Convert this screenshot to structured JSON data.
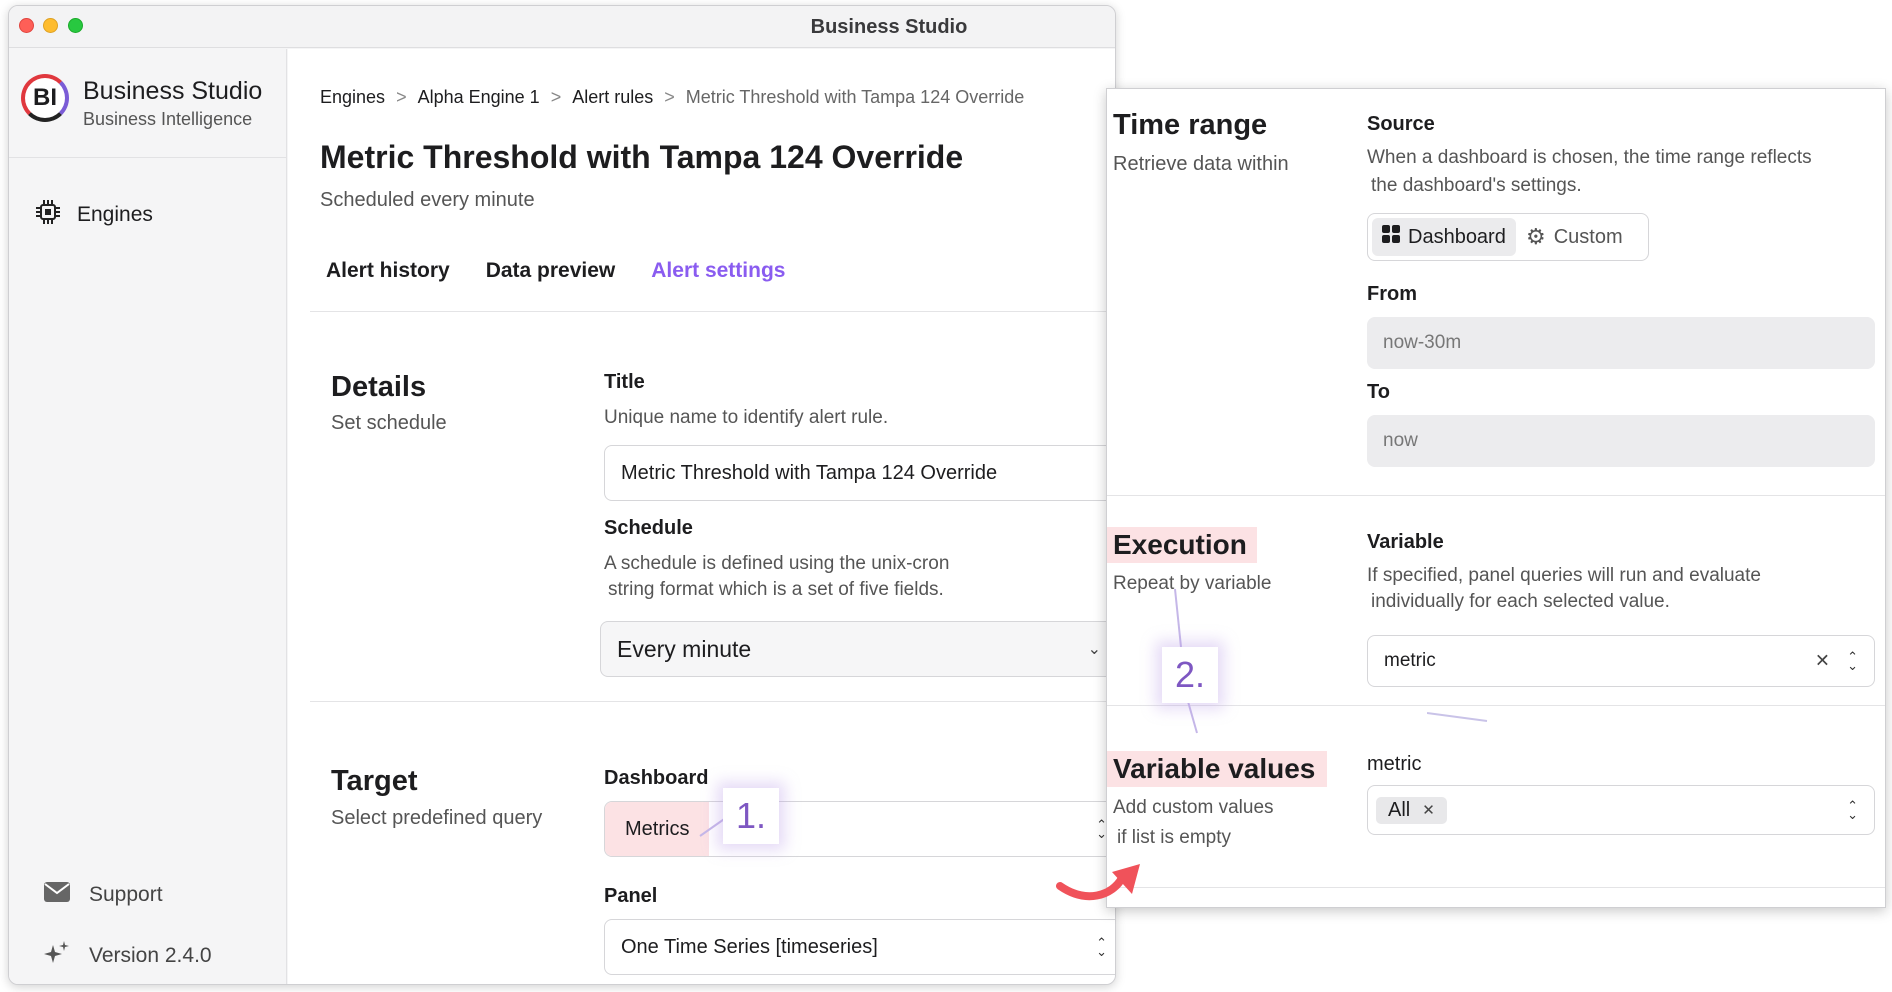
{
  "window": {
    "title": "Business Studio"
  },
  "sidebar": {
    "app_name": "Business Studio",
    "app_subtitle": "Business Intelligence",
    "logo_text": "BI",
    "nav": [
      {
        "label": "Engines",
        "icon": "chip-icon"
      }
    ],
    "footer": [
      {
        "label": "Support",
        "icon": "mail-icon"
      },
      {
        "label": "Version 2.4.0",
        "icon": "sparkles-icon"
      }
    ]
  },
  "breadcrumb": [
    "Engines",
    "Alpha Engine 1",
    "Alert rules",
    "Metric Threshold with Tampa 124 Override"
  ],
  "page": {
    "title": "Metric Threshold with Tampa 124 Override",
    "subtitle": "Scheduled every minute"
  },
  "tabs": [
    {
      "label": "Alert history",
      "active": false
    },
    {
      "label": "Data preview",
      "active": false
    },
    {
      "label": "Alert settings",
      "active": true
    }
  ],
  "details": {
    "heading": "Details",
    "subheading": "Set schedule",
    "title_label": "Title",
    "title_desc": "Unique name to identify alert rule.",
    "title_value": "Metric Threshold with Tampa 124 Override",
    "schedule_label": "Schedule",
    "schedule_desc_1": "A schedule is defined using the unix-cron",
    "schedule_desc_2": "string format which is a set of five fields.",
    "schedule_value": "Every minute"
  },
  "target": {
    "heading": "Target",
    "subheading": "Select predefined query",
    "dashboard_label": "Dashboard",
    "dashboard_value": "Metrics",
    "panel_label": "Panel",
    "panel_value": "One Time Series [timeseries]"
  },
  "time_range": {
    "heading": "Time range",
    "subheading": "Retrieve data within",
    "source_label": "Source",
    "source_desc_1": "When a dashboard is chosen, the time range reflects",
    "source_desc_2": "the dashboard's settings.",
    "options": [
      {
        "label": "Dashboard",
        "icon": "grid-icon",
        "selected": true
      },
      {
        "label": "Custom",
        "icon": "gear-icon",
        "selected": false
      }
    ],
    "from_label": "From",
    "from_value": "now-30m",
    "to_label": "To",
    "to_value": "now"
  },
  "execution": {
    "heading": "Execution",
    "subheading": "Repeat by variable",
    "variable_label": "Variable",
    "variable_desc_1": "If specified, panel queries will run and evaluate",
    "variable_desc_2": "individually for each selected value.",
    "variable_value": "metric"
  },
  "variable_values": {
    "heading": "Variable values",
    "subheading_1": "Add custom values",
    "subheading_2": "if list is empty",
    "field_label": "metric",
    "chip": "All"
  },
  "annotations": {
    "one": "1.",
    "two": "2."
  },
  "colors": {
    "accent": "#8a5cf0",
    "highlight": "#fce2e4",
    "arrow": "#f0525a",
    "badge_text": "#7e57c2"
  }
}
